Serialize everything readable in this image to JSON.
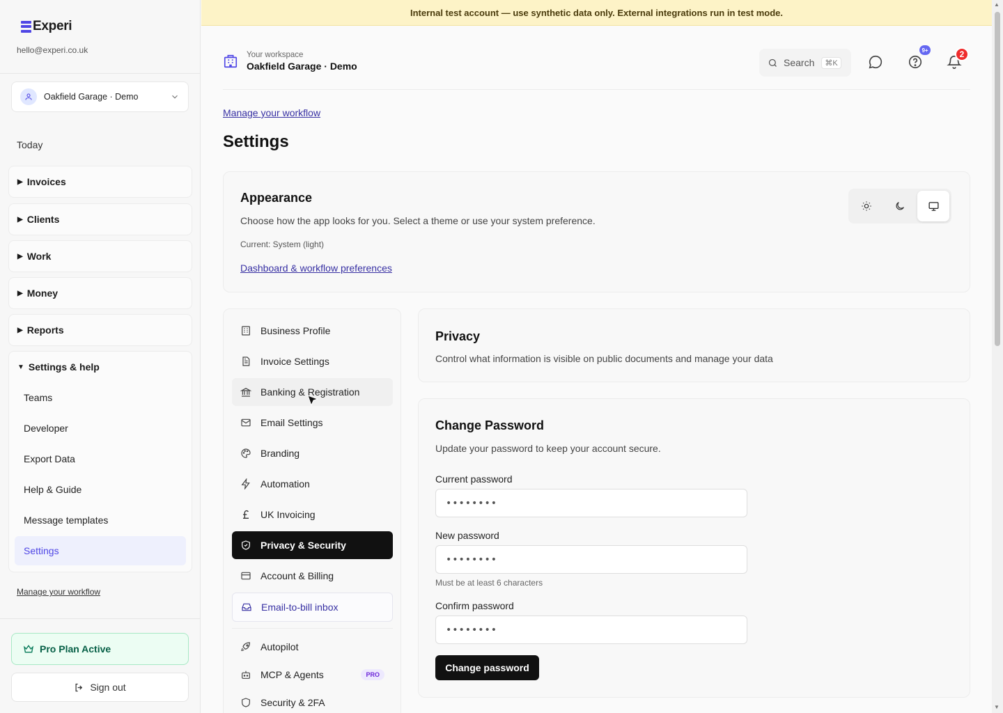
{
  "sidebar": {
    "brand": "Experi",
    "email": "hello@experi.co.uk",
    "workspace_selector": "Oakfield Garage · Demo",
    "today": "Today",
    "groups": [
      {
        "label": "Invoices"
      },
      {
        "label": "Clients"
      },
      {
        "label": "Work"
      },
      {
        "label": "Money"
      },
      {
        "label": "Reports"
      }
    ],
    "settings_group": {
      "label": "Settings & help",
      "items": [
        {
          "label": "Teams"
        },
        {
          "label": "Developer"
        },
        {
          "label": "Export Data"
        },
        {
          "label": "Help & Guide"
        },
        {
          "label": "Message templates"
        },
        {
          "label": "Settings"
        }
      ]
    },
    "manage_link": "Manage your workflow",
    "pro_plan": "Pro Plan Active",
    "sign_out": "Sign out"
  },
  "banner": "Internal test account — use synthetic data only. External integrations run in test mode.",
  "header": {
    "workspace_label": "Your workspace",
    "workspace_name": "Oakfield Garage · Demo",
    "search_label": "Search",
    "search_shortcut": "⌘K",
    "help_badge": "9+",
    "notif_badge": "2"
  },
  "page": {
    "crumb_link": "Manage your workflow",
    "title": "Settings"
  },
  "appearance": {
    "title": "Appearance",
    "description": "Choose how the app looks for you. Select a theme or use your system preference.",
    "current": "Current: System (light)",
    "link": "Dashboard & workflow preferences",
    "selected_theme": "system"
  },
  "settings_nav": [
    {
      "label": "Business Profile",
      "icon": "building-icon"
    },
    {
      "label": "Invoice Settings",
      "icon": "document-icon"
    },
    {
      "label": "Banking & Registration",
      "icon": "bank-icon"
    },
    {
      "label": "Email Settings",
      "icon": "mail-icon"
    },
    {
      "label": "Branding",
      "icon": "palette-icon"
    },
    {
      "label": "Automation",
      "icon": "bolt-icon"
    },
    {
      "label": "UK Invoicing",
      "icon": "pound-icon"
    },
    {
      "label": "Privacy & Security",
      "icon": "shield-check-icon"
    },
    {
      "label": "Account & Billing",
      "icon": "card-icon"
    },
    {
      "label": "Email-to-bill inbox",
      "icon": "inbox-icon"
    },
    {
      "label": "Autopilot",
      "icon": "rocket-icon"
    },
    {
      "label": "MCP & Agents",
      "icon": "robot-icon",
      "badge": "PRO"
    },
    {
      "label": "Security & 2FA",
      "icon": "shield-icon"
    }
  ],
  "privacy": {
    "title": "Privacy",
    "description": "Control what information is visible on public documents and manage your data"
  },
  "change_password": {
    "title": "Change Password",
    "description": "Update your password to keep your account secure.",
    "current_label": "Current password",
    "current_value": "••••••••",
    "new_label": "New password",
    "new_value": "••••••••",
    "new_hint": "Must be at least 6 characters",
    "confirm_label": "Confirm password",
    "confirm_value": "••••••••",
    "submit": "Change password"
  },
  "colors": {
    "accent": "#4f46e5",
    "banner_bg": "#fdf3c7",
    "notif_badge": "#ef2b2b",
    "help_badge": "#6366f1",
    "pro_plan_bg": "#ecfdf3"
  }
}
